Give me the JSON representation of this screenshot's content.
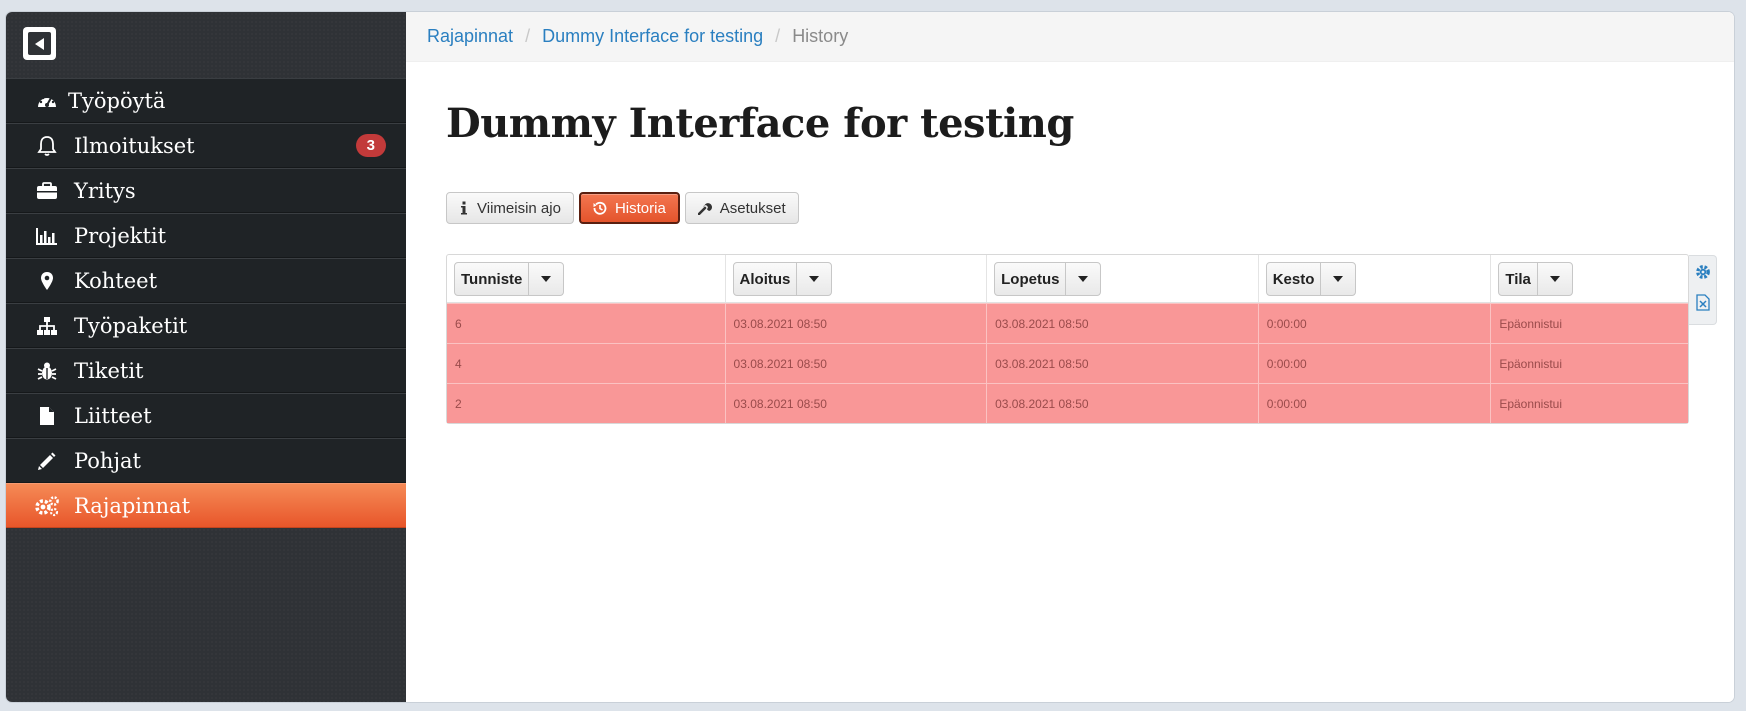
{
  "sidebar": {
    "logo_icon": "back-square-icon",
    "items": [
      {
        "label": "Työpöytä",
        "icon": "dashboard-icon"
      },
      {
        "label": "Ilmoitukset",
        "icon": "bell-icon",
        "badge": "3"
      },
      {
        "label": "Yritys",
        "icon": "briefcase-icon"
      },
      {
        "label": "Projektit",
        "icon": "bar-chart-icon"
      },
      {
        "label": "Kohteet",
        "icon": "map-marker-icon"
      },
      {
        "label": "Työpaketit",
        "icon": "sitemap-icon"
      },
      {
        "label": "Tiketit",
        "icon": "bug-icon"
      },
      {
        "label": "Liitteet",
        "icon": "file-icon"
      },
      {
        "label": "Pohjat",
        "icon": "pencil-icon"
      },
      {
        "label": "Rajapinnat",
        "icon": "cogs-icon",
        "active": true
      }
    ]
  },
  "breadcrumb": {
    "items": [
      "Rajapinnat",
      "Dummy Interface for testing"
    ],
    "current": "History"
  },
  "page": {
    "title": "Dummy Interface for testing"
  },
  "tabs": [
    {
      "label": "Viimeisin ajo",
      "icon": "info-icon"
    },
    {
      "label": "Historia",
      "icon": "history-icon",
      "active": true
    },
    {
      "label": "Asetukset",
      "icon": "wrench-icon"
    }
  ],
  "table": {
    "columns": [
      "Tunniste",
      "Aloitus",
      "Lopetus",
      "Kesto",
      "Tila"
    ],
    "rows": [
      [
        "6",
        "03.08.2021 08:50",
        "03.08.2021 08:50",
        "0:00:00",
        "Epäonnistui"
      ],
      [
        "4",
        "03.08.2021 08:50",
        "03.08.2021 08:50",
        "0:00:00",
        "Epäonnistui"
      ],
      [
        "2",
        "03.08.2021 08:50",
        "03.08.2021 08:50",
        "0:00:00",
        "Epäonnistui"
      ]
    ]
  },
  "tools": [
    "settings-gear-icon",
    "excel-export-icon"
  ],
  "colors": {
    "accent": "#e8562a",
    "link": "#2a7fc0",
    "failed_row": "#f99797",
    "badge": "#c23a3a",
    "sidebar": "#2f3236"
  }
}
